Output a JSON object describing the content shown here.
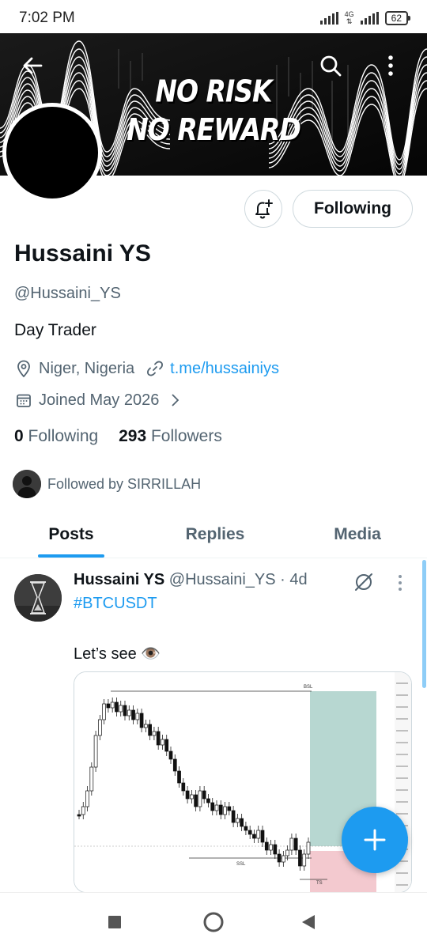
{
  "status": {
    "time": "7:02 PM",
    "network": "4G",
    "battery": "62"
  },
  "banner": {
    "line1": "NO RISK",
    "line2": "NO REWARD"
  },
  "header": {
    "back_icon": "arrow-left-icon",
    "search_icon": "search-icon",
    "more_icon": "more-vertical-icon"
  },
  "actions": {
    "notify_icon": "bell-plus-icon",
    "follow_label": "Following"
  },
  "profile": {
    "name": "Hussaini YS",
    "handle": "@Hussaini_YS",
    "bio": "Day Trader",
    "location": "Niger, Nigeria",
    "link": "t.me/hussainiys",
    "joined": "Joined May 2026",
    "following_count": "0",
    "following_label": "Following",
    "followers_count": "293",
    "followers_label": "Followers",
    "followed_by": "Followed by SIRRILLAH"
  },
  "tabs": [
    {
      "label": "Posts",
      "active": true
    },
    {
      "label": "Replies",
      "active": false
    },
    {
      "label": "Media",
      "active": false
    }
  ],
  "post": {
    "author": "Hussaini YS",
    "handle": "@Hussaini_YS",
    "separator": "·",
    "time": "4d",
    "hashtag": "#BTCUSDT",
    "text": "Let’s see 👁️",
    "chart_labels": {
      "top": "BSL",
      "mid": "SSL",
      "bottom": "TS"
    }
  },
  "colors": {
    "accent": "#1d9bf0",
    "text_primary": "#0f1419",
    "text_secondary": "#536471",
    "take_profit_zone": "#b7d7d1",
    "stop_loss_zone": "#f3c9cf"
  }
}
